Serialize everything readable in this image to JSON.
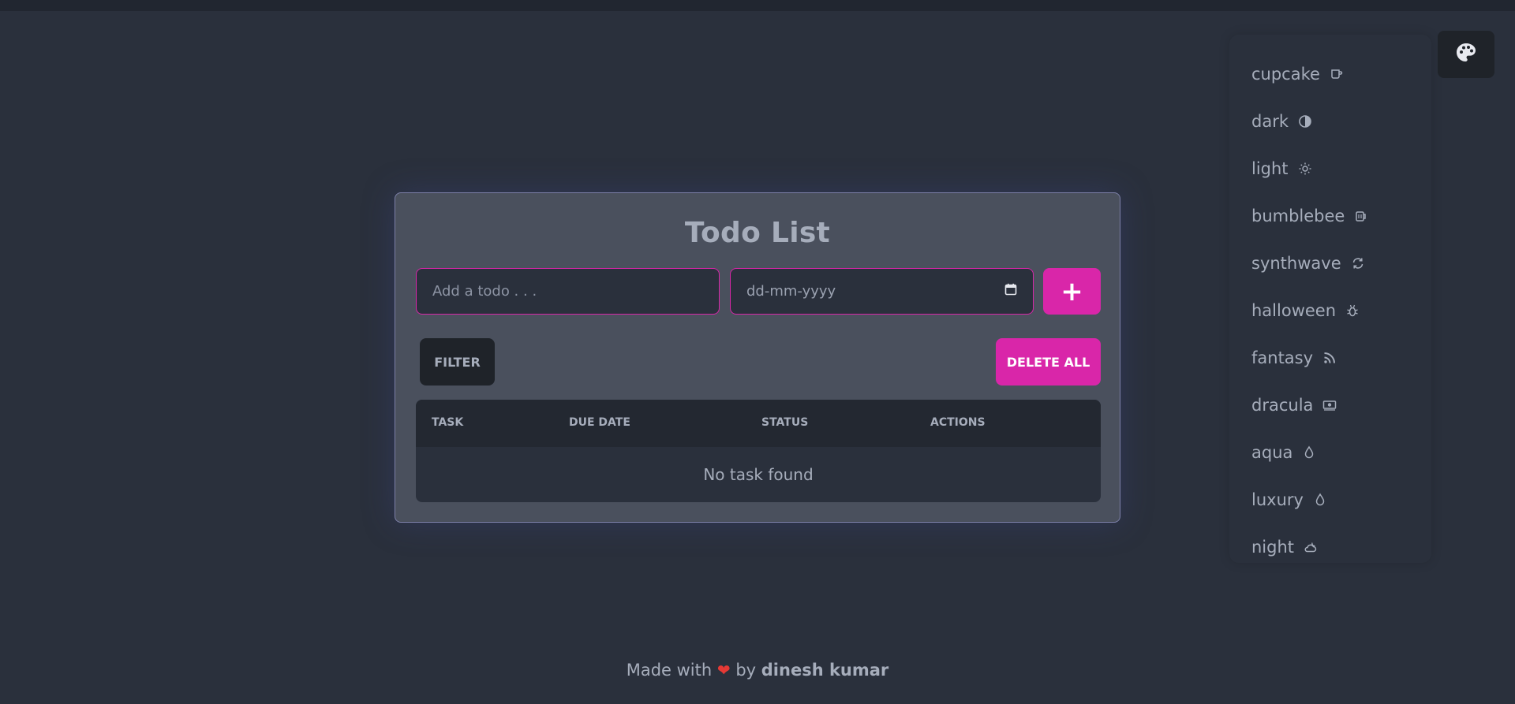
{
  "app": {
    "title": "Todo List",
    "todo_placeholder": "Add a todo . . .",
    "date_placeholder": "dd-mm-yyyy",
    "add_label": "+",
    "filter_label": "FILTER",
    "delete_all_label": "DELETE ALL",
    "accent_color": "#d926a9"
  },
  "table": {
    "headers": [
      "TASK",
      "DUE DATE",
      "STATUS",
      "ACTIONS"
    ],
    "empty_message": "No task found"
  },
  "themes": [
    {
      "label": "cupcake",
      "icon": "cup-icon"
    },
    {
      "label": "dark",
      "icon": "contrast-icon"
    },
    {
      "label": "light",
      "icon": "sun-icon"
    },
    {
      "label": "bumblebee",
      "icon": "beer-mug-icon"
    },
    {
      "label": "synthwave",
      "icon": "refresh-icon"
    },
    {
      "label": "halloween",
      "icon": "bug-icon"
    },
    {
      "label": "fantasy",
      "icon": "rss-icon"
    },
    {
      "label": "dracula",
      "icon": "money-icon"
    },
    {
      "label": "aqua",
      "icon": "droplet-icon"
    },
    {
      "label": "luxury",
      "icon": "droplet-icon"
    },
    {
      "label": "night",
      "icon": "cloud-moon-icon"
    }
  ],
  "footer": {
    "prefix": "Made with",
    "heart": "❤",
    "by": "by",
    "author": "dinesh kumar"
  }
}
